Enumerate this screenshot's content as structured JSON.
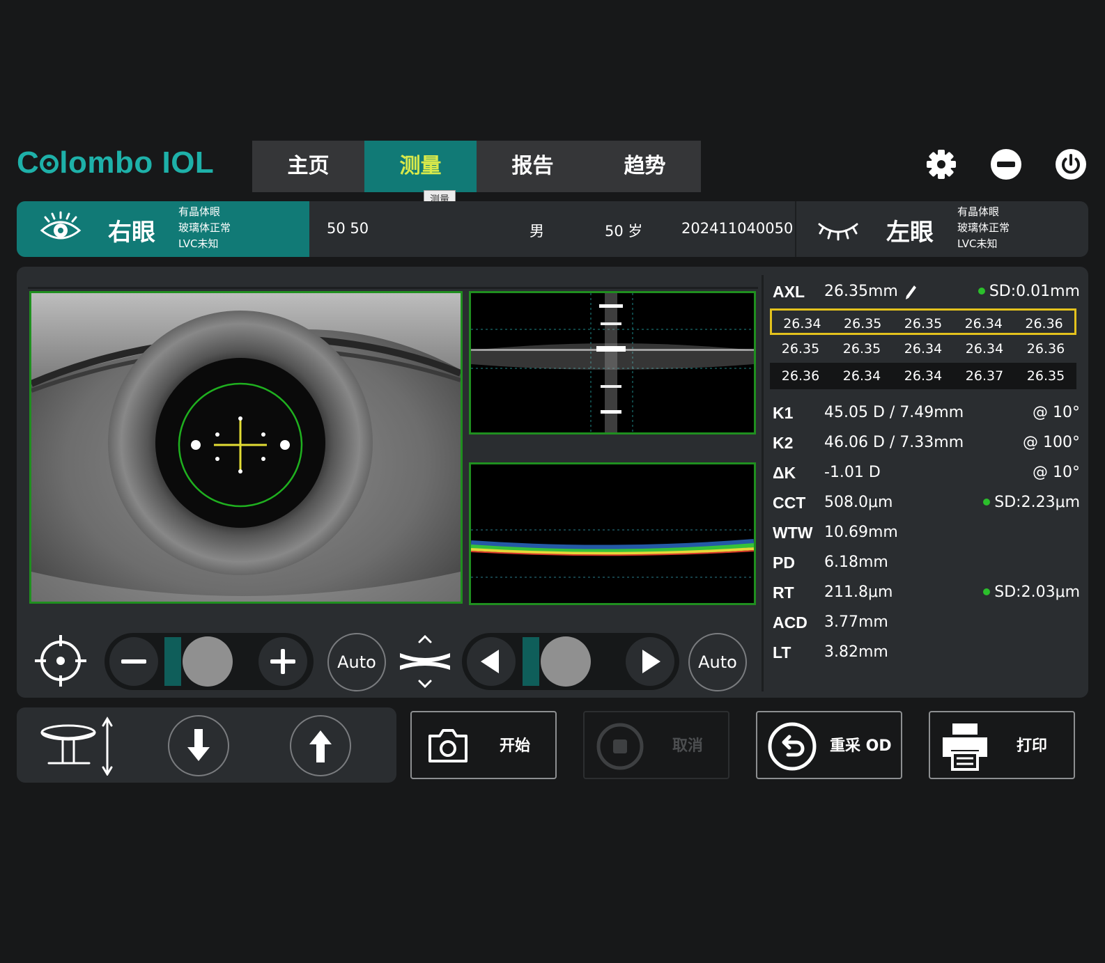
{
  "app": {
    "logo_prefix": "C",
    "logo_suffix": "lombo IOL"
  },
  "nav": {
    "tabs": [
      {
        "label": "主页",
        "active": false
      },
      {
        "label": "测量",
        "active": true
      },
      {
        "label": "报告",
        "active": false
      },
      {
        "label": "趋势",
        "active": false
      }
    ],
    "tooltip": "测量"
  },
  "header_icons": [
    "gear-icon",
    "minimize-icon",
    "power-icon"
  ],
  "patient": {
    "right_eye": {
      "label": "右眼",
      "info": [
        "有晶体眼",
        "玻璃体正常",
        "LVC未知"
      ]
    },
    "name": "50 50",
    "sex": "男",
    "age": "50 岁",
    "id": "202411040050",
    "left_eye": {
      "label": "左眼",
      "info": [
        "有晶体眼",
        "玻璃体正常",
        "LVC未知"
      ]
    }
  },
  "controls": {
    "focus_auto_label": "Auto",
    "position_auto_label": "Auto",
    "focus_slider_value": 0.2,
    "position_slider_value": 0.2
  },
  "measurements": {
    "axl": {
      "label": "AXL",
      "value": "26.35mm",
      "sd": "SD:0.01mm"
    },
    "axl_grid": [
      [
        "26.34",
        "26.35",
        "26.35",
        "26.34",
        "26.36"
      ],
      [
        "26.35",
        "26.35",
        "26.34",
        "26.34",
        "26.36"
      ],
      [
        "26.36",
        "26.34",
        "26.34",
        "26.37",
        "26.35"
      ]
    ],
    "k1": {
      "label": "K1",
      "value": "45.05 D / 7.49mm",
      "axis": "@ 10°"
    },
    "k2": {
      "label": "K2",
      "value": "46.06 D / 7.33mm",
      "axis": "@ 100°"
    },
    "dk": {
      "label": "ΔK",
      "value": "-1.01 D",
      "axis": "@ 10°"
    },
    "cct": {
      "label": "CCT",
      "value": "508.0μm",
      "sd": "SD:2.23μm"
    },
    "wtw": {
      "label": "WTW",
      "value": "10.69mm"
    },
    "pd": {
      "label": "PD",
      "value": "6.18mm"
    },
    "rt": {
      "label": "RT",
      "value": "211.8μm",
      "sd": "SD:2.03μm"
    },
    "acd": {
      "label": "ACD",
      "value": "3.77mm"
    },
    "lt": {
      "label": "LT",
      "value": "3.82mm"
    }
  },
  "actions": {
    "start": "开始",
    "cancel": "取消",
    "retake": "重采 OD",
    "print": "打印"
  },
  "colors": {
    "accent": "#117a76",
    "accent_text": "#d9e94a",
    "logo": "#1eb1a9",
    "selection": "#e4c21d",
    "frame": "#1f8f1f"
  }
}
